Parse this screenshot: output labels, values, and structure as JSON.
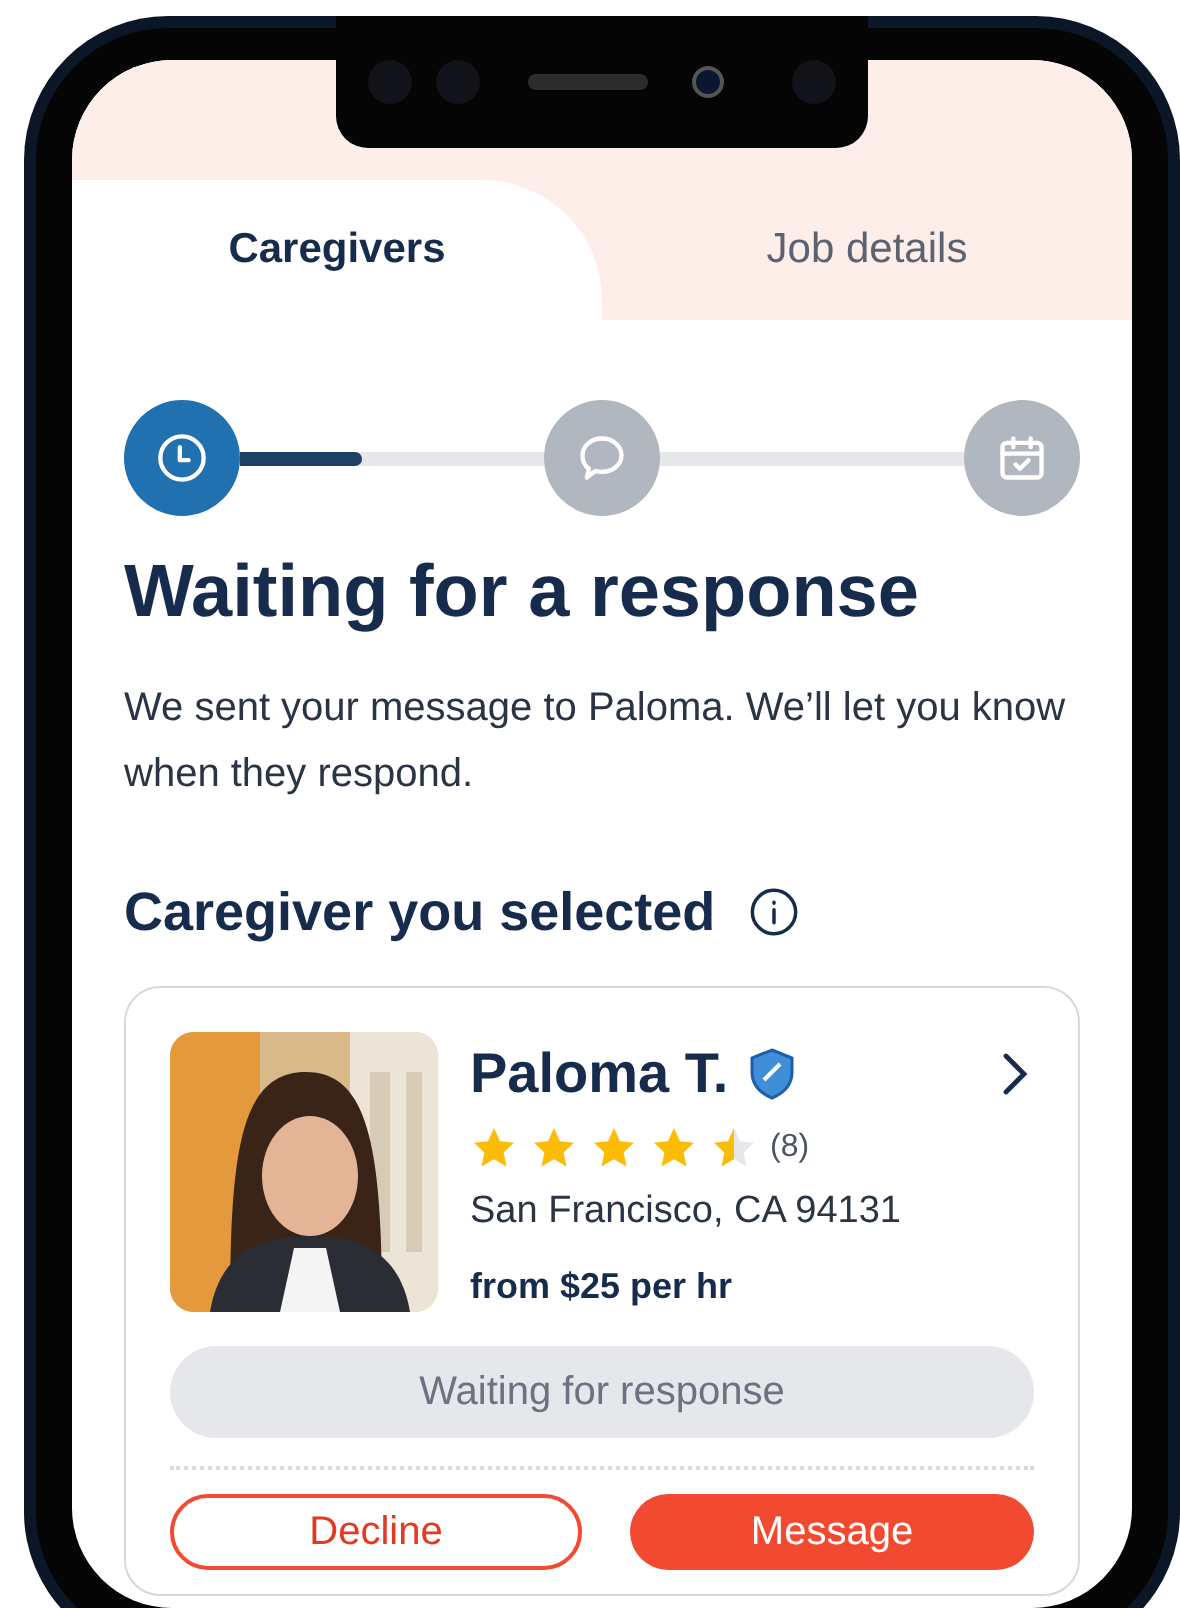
{
  "tabs": [
    {
      "label": "Caregivers",
      "selected": true
    },
    {
      "label": "Job details",
      "selected": false
    }
  ],
  "steps": [
    {
      "kind": "clock",
      "done": true
    },
    {
      "kind": "chat",
      "done": false
    },
    {
      "kind": "calendar",
      "done": false
    }
  ],
  "progress": {
    "level": 0.4
  },
  "title": "Waiting for a response",
  "message": "We sent your message to Paloma. We’ll let you know when they respond.",
  "section_title": "Caregiver you selected",
  "caregiver": {
    "name": "Paloma T.",
    "verified": true,
    "stars": 4.5,
    "review_count": "(8)",
    "location": "San Francisco, CA 94131",
    "rate": "from $25 per hr",
    "status": "Waiting for response"
  },
  "buttons": [
    {
      "label": "Decline",
      "kind": "secondary"
    },
    {
      "label": "Message",
      "kind": "primary"
    }
  ]
}
